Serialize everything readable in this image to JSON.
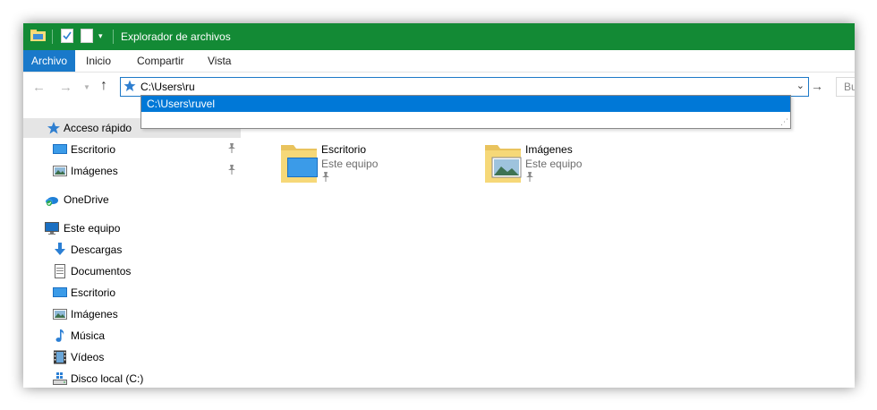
{
  "window": {
    "title": "Explorador de archivos",
    "accent_color": "#138a35",
    "quick_access_icons": [
      "folder-icon",
      "properties-icon",
      "new-folder-icon",
      "customize-dropdown-icon"
    ]
  },
  "ribbon": {
    "tabs": [
      {
        "label": "Archivo",
        "active": true
      },
      {
        "label": "Inicio"
      },
      {
        "label": "Compartir"
      },
      {
        "label": "Vista"
      }
    ]
  },
  "nav": {
    "address_value": "C:\\Users\\ru",
    "search_placeholder": "Bu",
    "autocomplete": [
      "C:\\Users\\ruvel"
    ]
  },
  "sidebar": {
    "quick_access": {
      "label": "Acceso rápido",
      "icon": "star-icon"
    },
    "quick_items": [
      {
        "label": "Escritorio",
        "icon": "desktop-icon",
        "pin": "📌"
      },
      {
        "label": "Imágenes",
        "icon": "pictures-icon",
        "pin": "📌"
      }
    ],
    "onedrive": {
      "label": "OneDrive",
      "icon": "cloud-icon"
    },
    "this_pc": {
      "label": "Este equipo",
      "icon": "monitor-icon"
    },
    "pc_items": [
      {
        "label": "Descargas",
        "icon": "download-icon"
      },
      {
        "label": "Documentos",
        "icon": "document-icon"
      },
      {
        "label": "Escritorio",
        "icon": "desktop-icon"
      },
      {
        "label": "Imágenes",
        "icon": "pictures-icon"
      },
      {
        "label": "Música",
        "icon": "music-icon"
      },
      {
        "label": "Vídeos",
        "icon": "video-icon"
      },
      {
        "label": "Disco local (C:)",
        "icon": "drive-icon"
      }
    ]
  },
  "content": {
    "tiles": [
      {
        "name": "Escritorio",
        "location": "Este equipo",
        "icon": "desktop-folder-icon"
      },
      {
        "name": "Imágenes",
        "location": "Este equipo",
        "icon": "pictures-folder-icon"
      }
    ]
  }
}
